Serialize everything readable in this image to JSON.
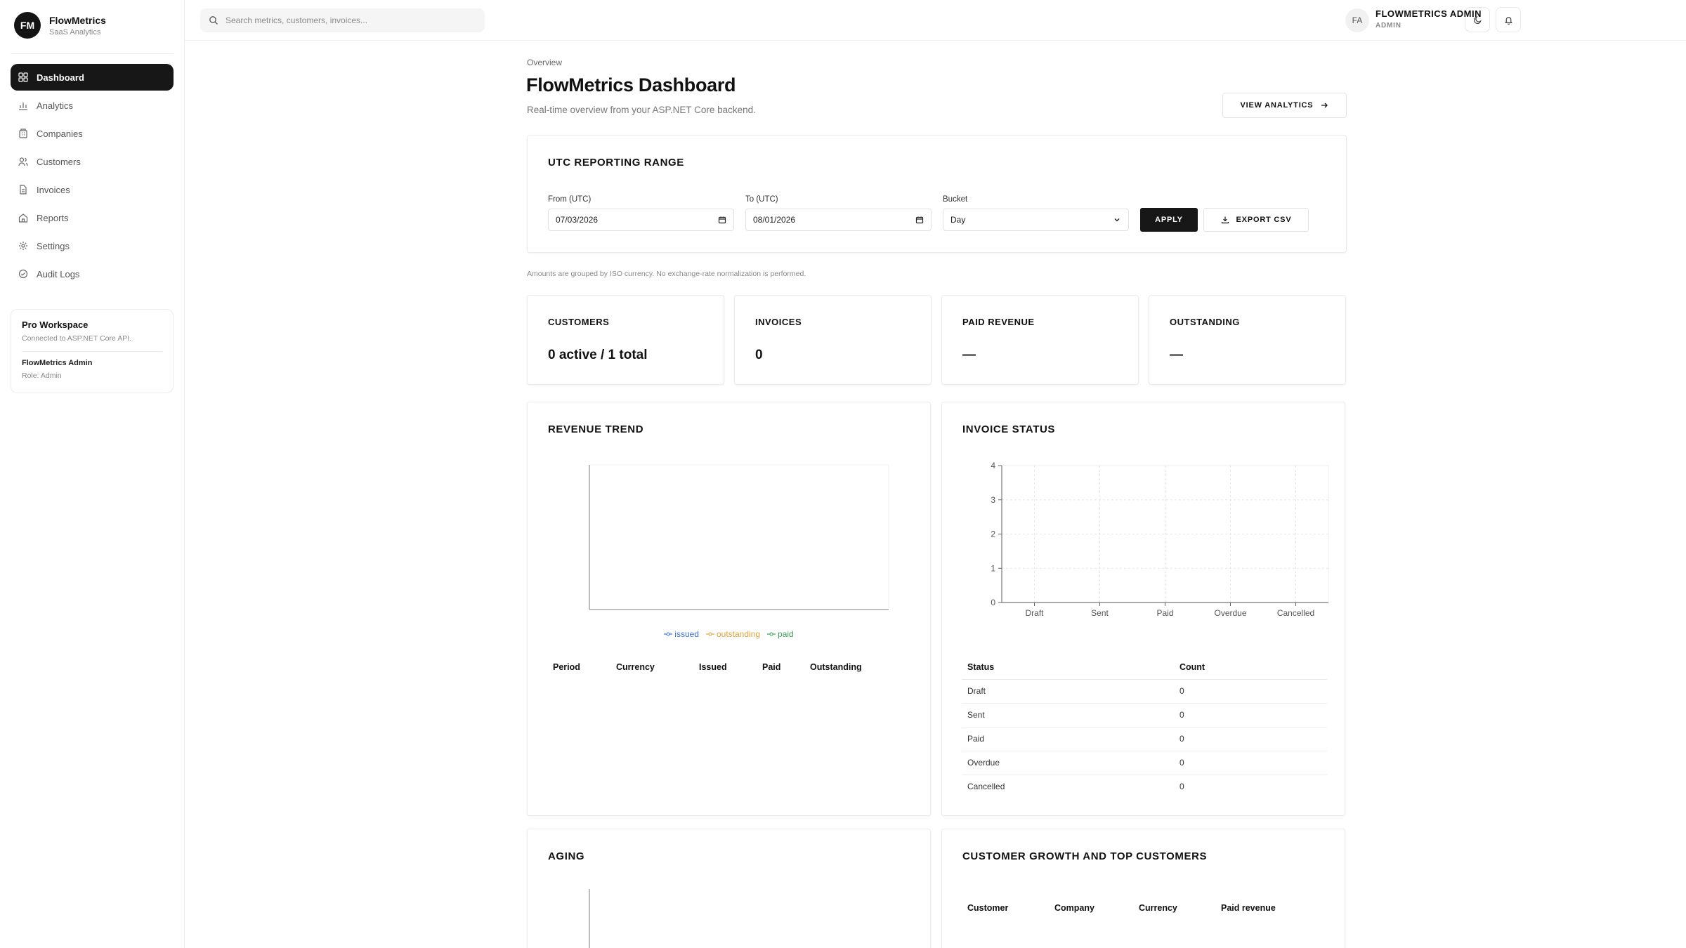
{
  "brand": {
    "initials": "FM",
    "name": "FlowMetrics",
    "subtitle": "SaaS Analytics"
  },
  "sidebar": {
    "items": [
      {
        "label": "Dashboard",
        "icon": "grid-icon",
        "active": true
      },
      {
        "label": "Analytics",
        "icon": "bar-chart-icon"
      },
      {
        "label": "Companies",
        "icon": "building-icon"
      },
      {
        "label": "Customers",
        "icon": "users-icon"
      },
      {
        "label": "Invoices",
        "icon": "file-icon"
      },
      {
        "label": "Reports",
        "icon": "home-icon"
      },
      {
        "label": "Settings",
        "icon": "gear-icon"
      },
      {
        "label": "Audit Logs",
        "icon": "shield-check-icon"
      }
    ],
    "workspace": {
      "title": "Pro Workspace",
      "subtitle": "Connected to ASP.NET Core API.",
      "user": "FlowMetrics Admin",
      "role": "Role: Admin"
    }
  },
  "topbar": {
    "search_placeholder": "Search metrics, customers, invoices...",
    "avatar_initials": "FA",
    "user_name": "FLOWMETRICS ADMIN",
    "user_role": "ADMIN"
  },
  "header": {
    "breadcrumb": "Overview",
    "title": "FlowMetrics Dashboard",
    "subtitle": "Real-time overview from your ASP.NET Core backend.",
    "view_analytics_label": "VIEW ANALYTICS"
  },
  "range": {
    "title": "UTC REPORTING RANGE",
    "from_label": "From (UTC)",
    "from_value": "07/03/2026",
    "to_label": "To (UTC)",
    "to_value": "08/01/2026",
    "bucket_label": "Bucket",
    "bucket_value": "Day",
    "apply_label": "APPLY",
    "export_label": "EXPORT CSV"
  },
  "note": "Amounts are grouped by ISO currency. No exchange-rate normalization is performed.",
  "stats": [
    {
      "label": "CUSTOMERS",
      "value": "0 active / 1 total"
    },
    {
      "label": "INVOICES",
      "value": "0"
    },
    {
      "label": "PAID REVENUE",
      "value": "—"
    },
    {
      "label": "OUTSTANDING",
      "value": "—"
    }
  ],
  "revenue": {
    "title": "REVENUE TREND",
    "legend": [
      {
        "name": "issued",
        "color": "#3b6fd4"
      },
      {
        "name": "outstanding",
        "color": "#e0a23a"
      },
      {
        "name": "paid",
        "color": "#3f9e5c"
      }
    ],
    "columns": [
      "Period",
      "Currency",
      "Issued",
      "Paid",
      "Outstanding"
    ]
  },
  "invoice_status": {
    "title": "INVOICE STATUS",
    "columns": [
      "Status",
      "Count"
    ],
    "rows": [
      {
        "status": "Draft",
        "count": "0"
      },
      {
        "status": "Sent",
        "count": "0"
      },
      {
        "status": "Paid",
        "count": "0"
      },
      {
        "status": "Overdue",
        "count": "0"
      },
      {
        "status": "Cancelled",
        "count": "0"
      }
    ]
  },
  "chart_data": {
    "type": "bar",
    "categories": [
      "Draft",
      "Sent",
      "Paid",
      "Overdue",
      "Cancelled"
    ],
    "values": [
      0,
      0,
      0,
      0,
      0
    ],
    "yticks": [
      "0",
      "1",
      "2",
      "3",
      "4"
    ],
    "ylim": [
      0,
      4
    ],
    "grid": true
  },
  "aging": {
    "title": "AGING"
  },
  "growth": {
    "title": "CUSTOMER GROWTH AND TOP CUSTOMERS",
    "columns": [
      "Customer",
      "Company",
      "Currency",
      "Paid revenue"
    ]
  }
}
